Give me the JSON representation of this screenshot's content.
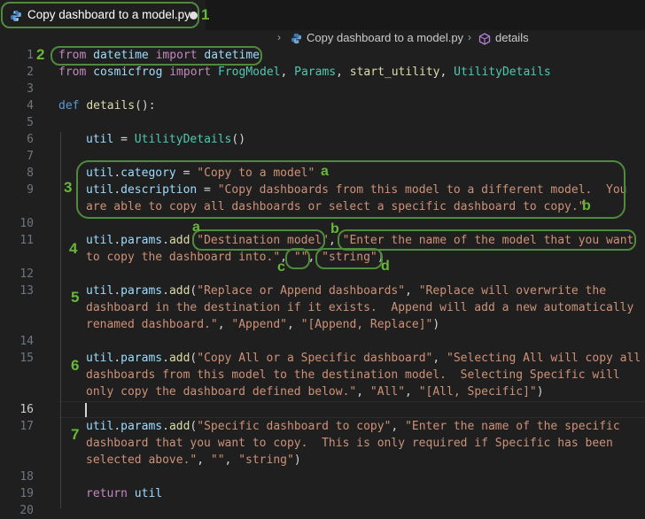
{
  "tab": {
    "filename": "Copy dashboard to a model.py",
    "icon": "python-file-icon"
  },
  "breadcrumb": {
    "file": "Copy dashboard to a model.py",
    "symbol": "details"
  },
  "line_numbers": [
    "1",
    "2",
    "3",
    "4",
    "5",
    "6",
    "7",
    "8",
    "9",
    "10",
    "11",
    "12",
    "13",
    "14",
    "15",
    "16",
    "17",
    "18",
    "19",
    "20"
  ],
  "code": {
    "l1": {
      "a": "from",
      "b": " datetime ",
      "c": "import",
      "d": " datetime"
    },
    "l2": {
      "a": "from",
      "b": " cosmicfrog ",
      "c": "import",
      "d": " FrogModel",
      "e": ", ",
      "f": "Params",
      "g": ", ",
      "h": "start_utility",
      "i": ", ",
      "j": "UtilityDetails"
    },
    "l4": {
      "a": "def",
      "b": " ",
      "c": "details",
      "d": "():"
    },
    "l6": {
      "a": "util",
      "b": " = ",
      "c": "UtilityDetails",
      "d": "()"
    },
    "l8": {
      "a": "util",
      "b": ".",
      "c": "category",
      "d": " = ",
      "e": "\"Copy to a model\""
    },
    "l9": {
      "a": "util",
      "b": ".",
      "c": "description",
      "d": " = ",
      "e": "\"Copy dashboards from this model to a different model.  You"
    },
    "l9b": {
      "a": "are able to copy all dashboards or select a specific dashboard to copy.\""
    },
    "l11": {
      "a": "util",
      "b": ".",
      "c": "params",
      "d": ".",
      "e": "add",
      "f": "(",
      "g": "\"Destination model\"",
      "h": ", ",
      "i": "\"Enter the name of the model that you want"
    },
    "l11b": {
      "a": "to copy the dashboard into.\"",
      "b": ", ",
      "c": "\"\"",
      "d": ", ",
      "e": "\"string\"",
      "f": ")"
    },
    "l13": {
      "a": "util",
      "b": ".",
      "c": "params",
      "d": ".",
      "e": "add",
      "f": "(",
      "g": "\"Replace or Append dashboards\"",
      "h": ", ",
      "i": "\"Replace will overwrite the"
    },
    "l13b": {
      "a": "dashboard in the destination if it exists.  Append will add a new automatically"
    },
    "l13c": {
      "a": "renamed dashboard.\"",
      "b": ", ",
      "c": "\"Append\"",
      "d": ", ",
      "e": "\"[Append, Replace]\"",
      "f": ")"
    },
    "l15": {
      "a": "util",
      "b": ".",
      "c": "params",
      "d": ".",
      "e": "add",
      "f": "(",
      "g": "\"Copy All or a Specific dashboard\"",
      "h": ", ",
      "i": "\"Selecting All will copy all"
    },
    "l15b": {
      "a": "dashboards from this model to the destination model.  Selecting Specific will"
    },
    "l15c": {
      "a": "only copy the dashboard defined below.\"",
      "b": ", ",
      "c": "\"All\"",
      "d": ", ",
      "e": "\"[All, Specific]\"",
      "f": ")"
    },
    "l17": {
      "a": "util",
      "b": ".",
      "c": "params",
      "d": ".",
      "e": "add",
      "f": "(",
      "g": "\"Specific dashboard to copy\"",
      "h": ", ",
      "i": "\"Enter the name of the specific"
    },
    "l17b": {
      "a": "dashboard that you want to copy.  This is only required if Specific has been"
    },
    "l17c": {
      "a": "selected above.\"",
      "b": ", ",
      "c": "\"\"",
      "d": ", ",
      "e": "\"string\"",
      "f": ")"
    },
    "l19": {
      "a": "return",
      "b": " util"
    }
  },
  "annotations": {
    "numbers": [
      "1",
      "2",
      "3",
      "4",
      "5",
      "6",
      "7"
    ],
    "letters": [
      "a",
      "b",
      "a",
      "b",
      "c",
      "d"
    ]
  },
  "colors": {
    "annotation": "#68b838",
    "background": "#1f1f1f"
  }
}
